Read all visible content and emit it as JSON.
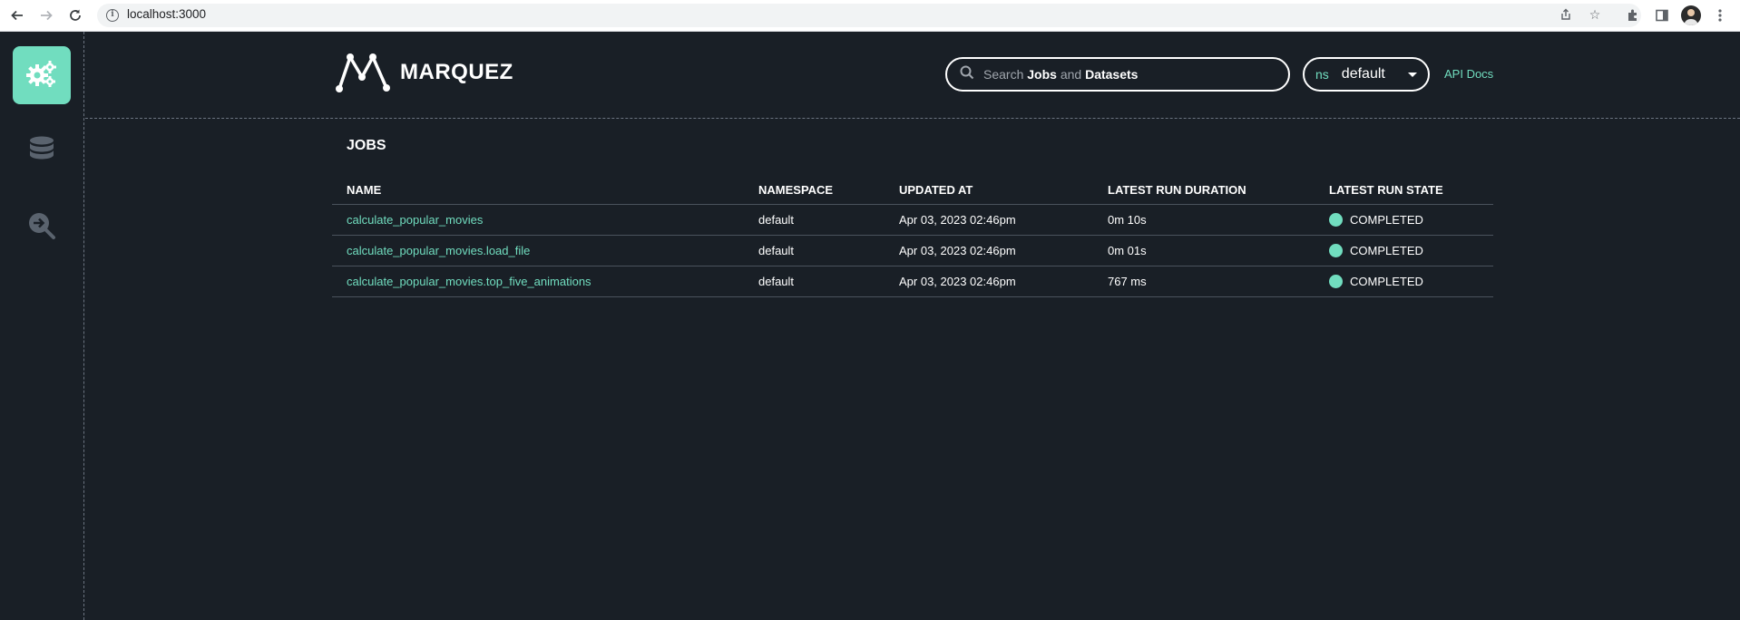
{
  "browser": {
    "url": "localhost:3000"
  },
  "app": {
    "brand": "MARQUEZ",
    "accent_color": "#71ddbf",
    "background_color": "#191f26"
  },
  "sidebar": {
    "items": [
      {
        "icon": "gears-icon",
        "active": true
      },
      {
        "icon": "database-icon",
        "active": false
      },
      {
        "icon": "lineage-search-icon",
        "active": false
      }
    ]
  },
  "header": {
    "search_prefix": "Search",
    "search_jobs": "Jobs",
    "search_and": "and",
    "search_datasets": "Datasets",
    "ns_label": "ns",
    "ns_value": "default",
    "api_docs": "API Docs"
  },
  "jobs": {
    "title": "JOBS",
    "columns": [
      "NAME",
      "NAMESPACE",
      "UPDATED AT",
      "LATEST RUN DURATION",
      "LATEST RUN STATE"
    ],
    "rows": [
      {
        "name": "calculate_popular_movies",
        "namespace": "default",
        "updated_at": "Apr 03, 2023 02:46pm",
        "duration": "0m 10s",
        "state": "COMPLETED",
        "state_color": "#71ddbf"
      },
      {
        "name": "calculate_popular_movies.load_file",
        "namespace": "default",
        "updated_at": "Apr 03, 2023 02:46pm",
        "duration": "0m 01s",
        "state": "COMPLETED",
        "state_color": "#71ddbf"
      },
      {
        "name": "calculate_popular_movies.top_five_animations",
        "namespace": "default",
        "updated_at": "Apr 03, 2023 02:46pm",
        "duration": "767 ms",
        "state": "COMPLETED",
        "state_color": "#71ddbf"
      }
    ]
  }
}
